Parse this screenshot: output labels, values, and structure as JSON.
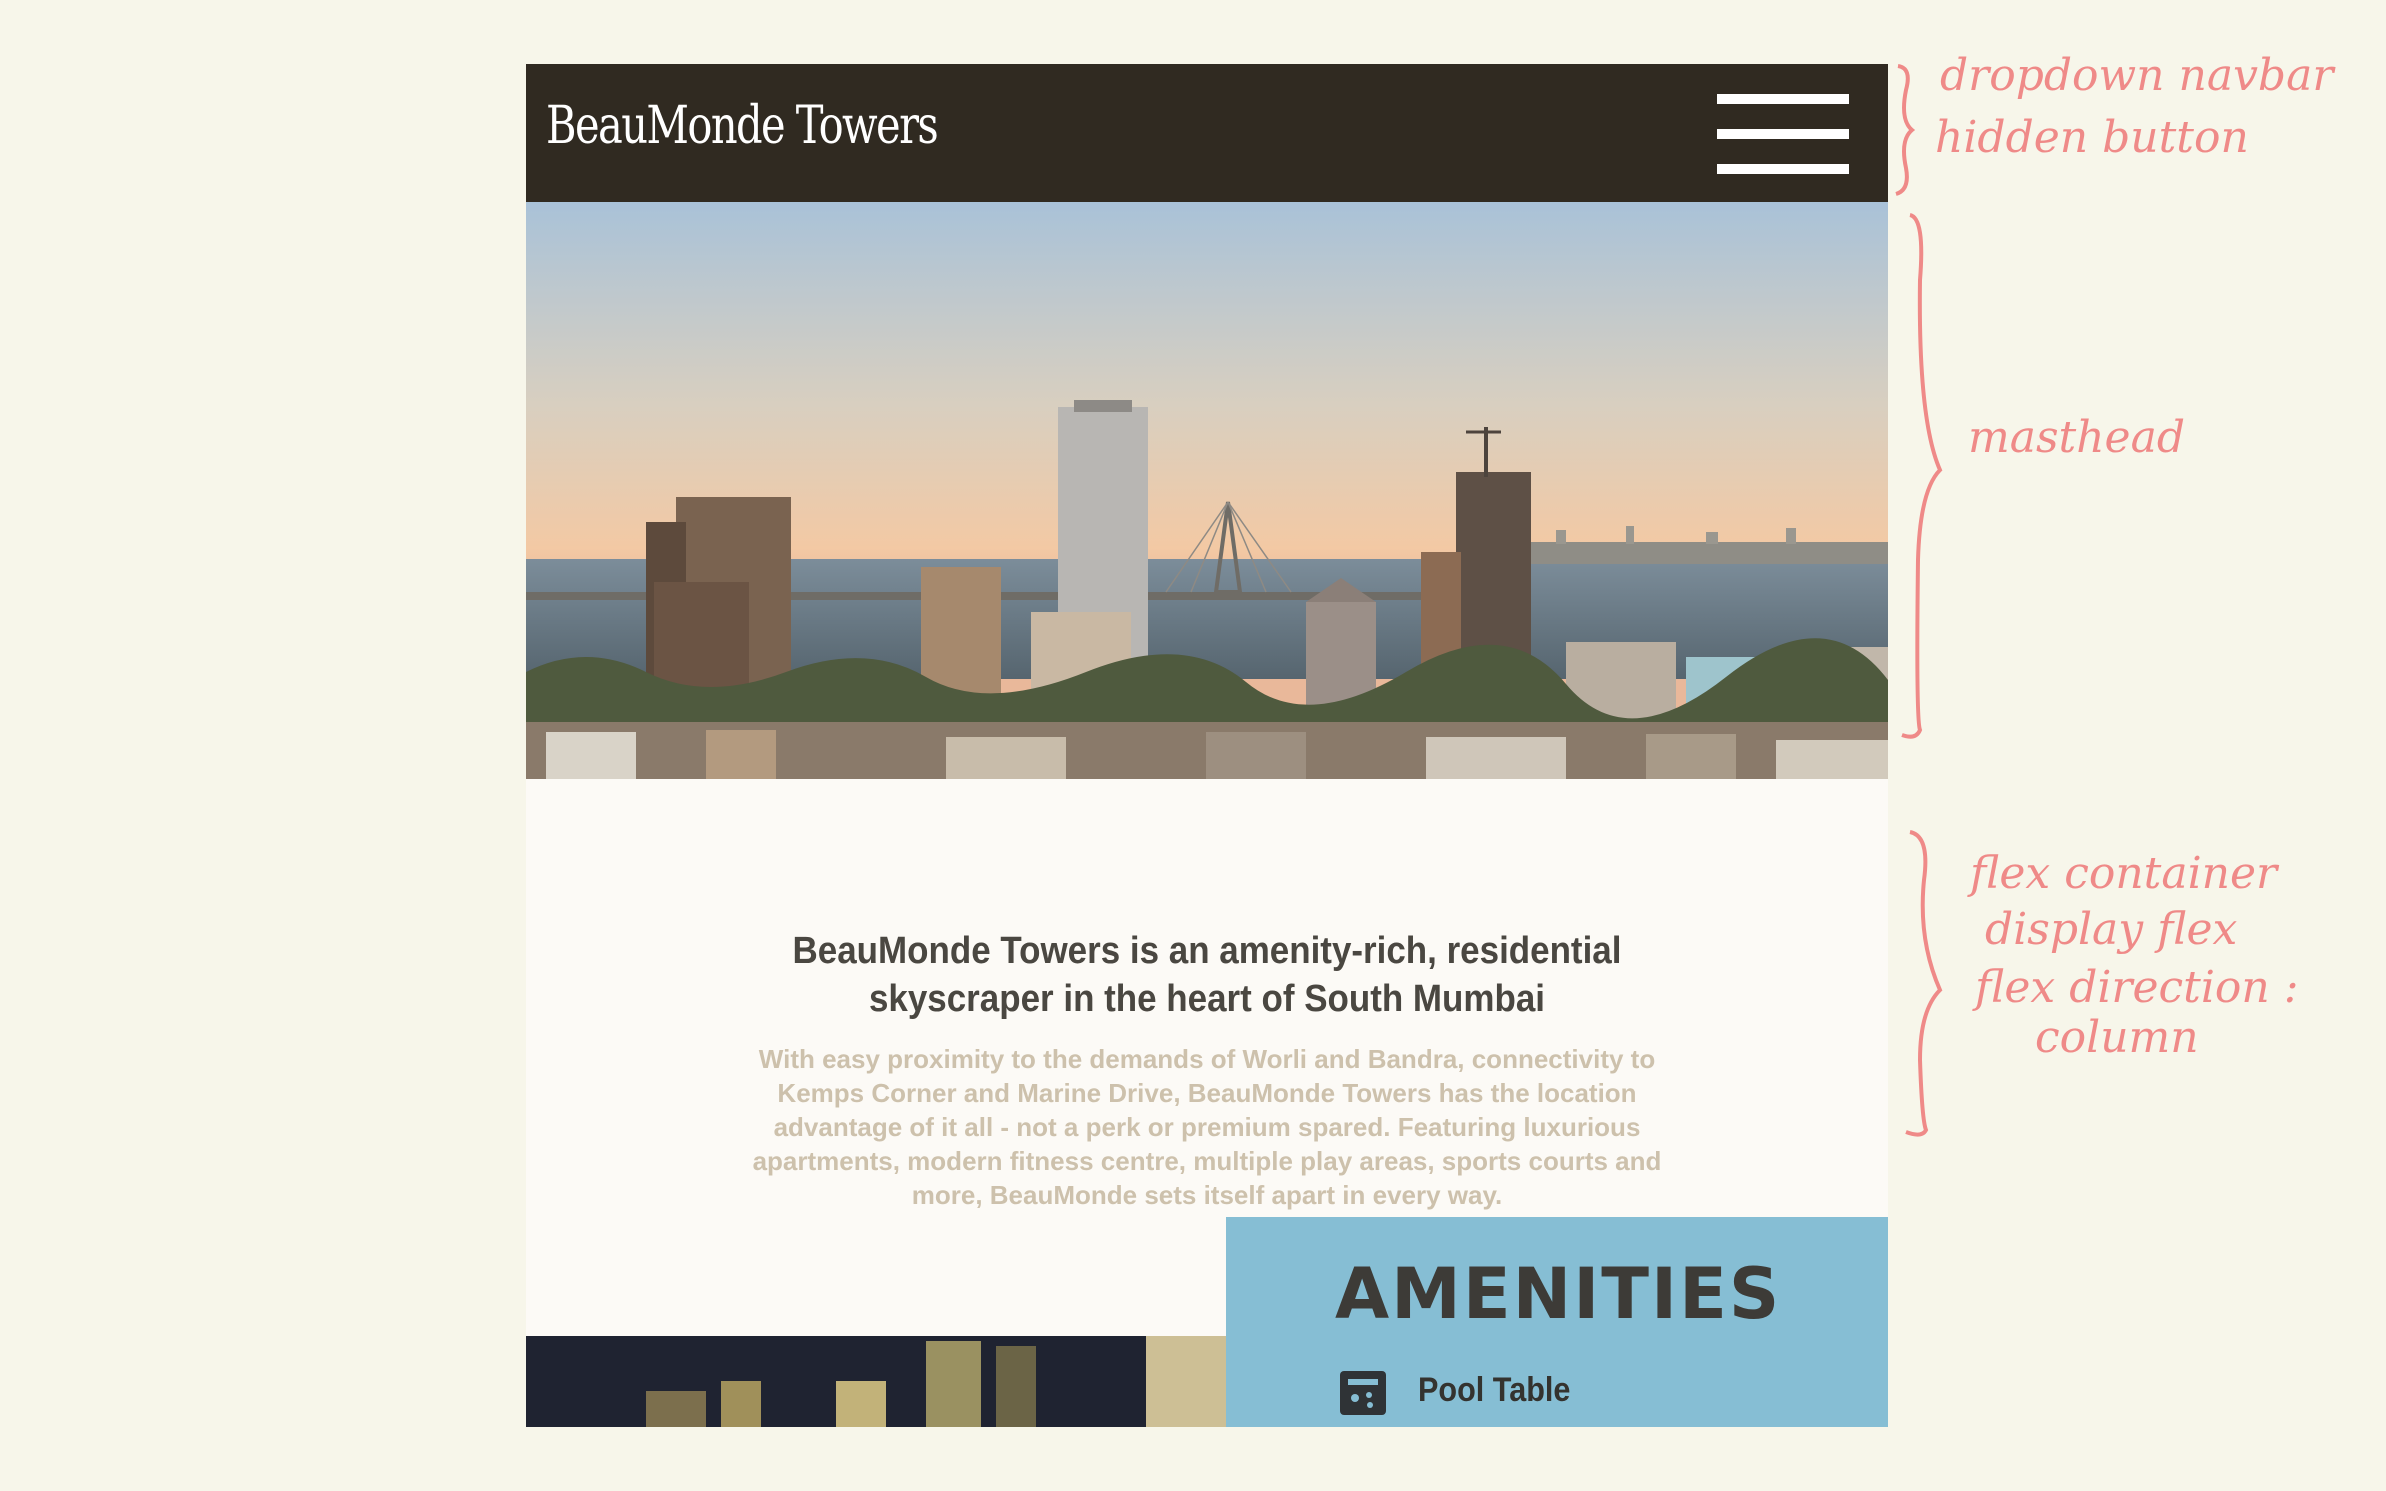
{
  "navbar": {
    "brand": "BeauMonde Towers",
    "menu_icon": "hamburger-menu-icon"
  },
  "masthead": {
    "image": "mumbai-skyline-sea-link-photo"
  },
  "intro": {
    "title": "BeauMonde Towers is an amenity-rich, residential skyscraper in the heart of South Mumbai",
    "body": "With easy proximity to the demands of Worli and Bandra, connectivity to Kemps Corner and Marine Drive, BeauMonde Towers has the location advantage of it all - not a perk or premium spared. Featuring luxurious apartments, modern fitness centre, multiple play areas, sports courts and more, BeauMonde sets itself apart in every way."
  },
  "amenities": {
    "title": "AMENITIES",
    "items": [
      {
        "label": "Pool Table",
        "icon": "pool-table-icon"
      }
    ]
  },
  "annotations": {
    "navbar_note_line1": "dropdown navbar",
    "navbar_note_line2": "hidden button",
    "masthead_note": "masthead",
    "flex_note_line1": "flex container",
    "flex_note_line2": "display flex",
    "flex_note_line3": "flex direction :",
    "flex_note_line4": "column"
  },
  "colors": {
    "page_bg": "#f7f6ea",
    "navbar_bg": "#302a21",
    "amenities_bg": "#86bed4",
    "annotation": "#ef8a88"
  }
}
